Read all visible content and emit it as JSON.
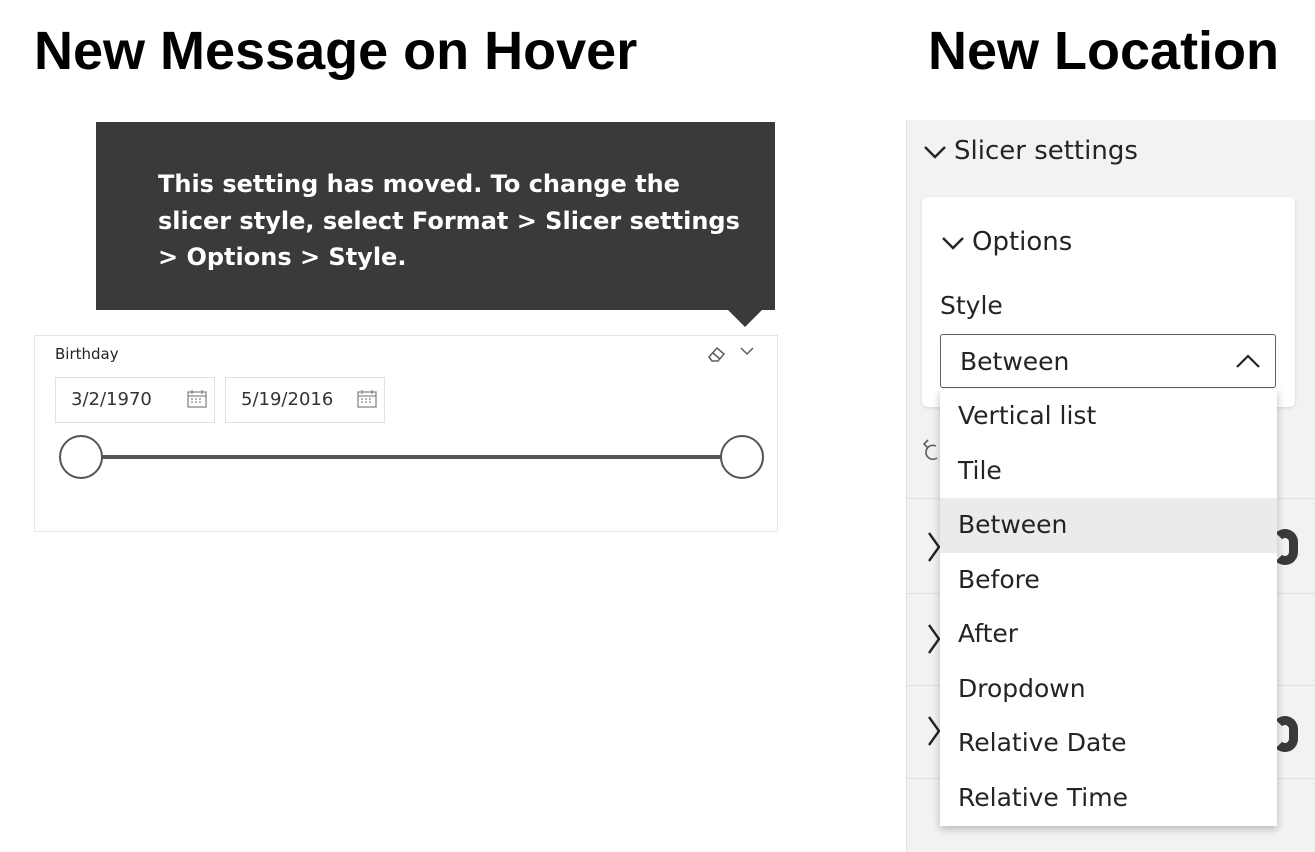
{
  "headings": {
    "left": "New Message on Hover",
    "right": "New Location"
  },
  "tooltip": {
    "text": "This setting has moved. To change the slicer style, select Format > Slicer settings > Options > Style."
  },
  "slicer": {
    "title": "Birthday",
    "start_date": "3/2/1970",
    "end_date": "5/19/2016"
  },
  "format_pane": {
    "section_title": "Slicer settings",
    "subsection_title": "Options",
    "style_label": "Style",
    "style_selected": "Between",
    "style_options": [
      "Vertical list",
      "Tile",
      "Between",
      "Before",
      "After",
      "Dropdown",
      "Relative Date",
      "Relative Time"
    ],
    "highlighted_option": "Between"
  },
  "colors": {
    "tooltip_bg": "#3b3a39",
    "pane_bg": "#f3f2f1",
    "selected_item_bg": "#edebe9"
  }
}
